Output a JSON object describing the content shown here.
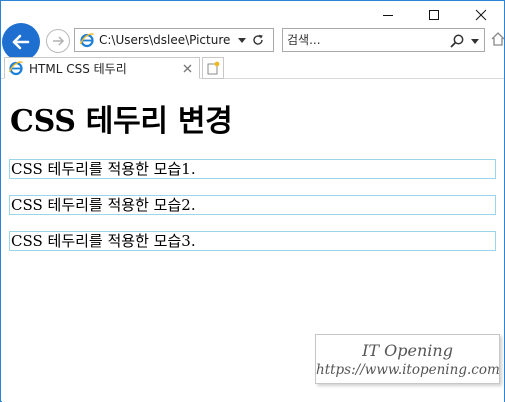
{
  "window": {
    "controls": [
      "minimize",
      "maximize",
      "close"
    ]
  },
  "nav": {
    "address": "C:\\Users\\dslee\\Pictures\\",
    "search_placeholder": "검색..."
  },
  "tab": {
    "title": "HTML CSS 테두리"
  },
  "page": {
    "heading": "CSS 테두리 변경",
    "boxes": [
      "CSS 테두리를 적용한 모습1.",
      "CSS 테두리를 적용한 모습2.",
      "CSS 테두리를 적용한 모습3."
    ],
    "box_border_color": "#99d6ea"
  },
  "watermark": {
    "title": "IT Opening",
    "url": "https://www.itopening.com"
  },
  "colors": {
    "frame": "#2b84d6",
    "back_button": "#1e6fd0"
  }
}
